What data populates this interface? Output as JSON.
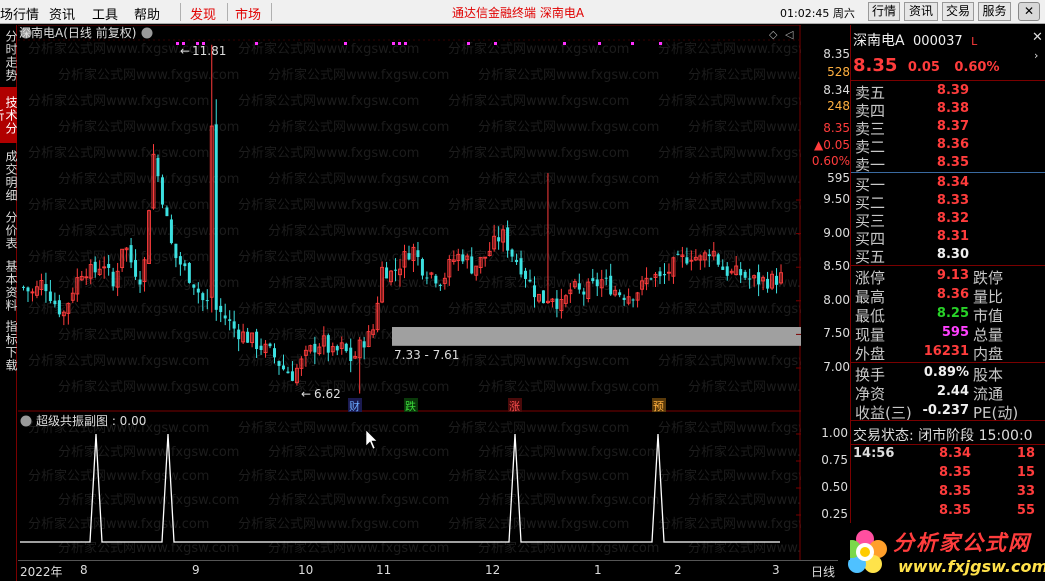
{
  "menu": {
    "items": [
      "场行情",
      "资讯",
      "工具",
      "帮助"
    ],
    "tabs_red": [
      "发现",
      "市场"
    ],
    "center_title": "通达信金融终端   深南电A",
    "clock": "01:02:45 周六",
    "right_buttons": [
      "行情",
      "资讯",
      "交易",
      "服务"
    ]
  },
  "left_tabs": [
    "分时走势",
    "技术分析",
    "成交明细",
    "分价表",
    "基本资料",
    "指标下载"
  ],
  "chart": {
    "title": "深南电A(日线 前复权)",
    "right_labels": {
      "price_hi": "8.35",
      "vol_hi": "528",
      "price_2": "8.34",
      "vol_2": "248",
      "price_3": "8.35",
      "change": "▲0.05",
      "pct": "0.60%",
      "vol_3": "595"
    },
    "annotation_high": "11.81",
    "annotation_low": "6.62",
    "annotation_range": "7.33 - 7.61",
    "event_marks": [
      "财",
      "跌",
      "涨",
      "预"
    ],
    "sub_title": "超级共振副图 : 0.00",
    "watermark": "分析家公式网www.fxgsw.com",
    "x_labels": [
      "2022年",
      "8",
      "9",
      "10",
      "11",
      "12",
      "1",
      "2",
      "3"
    ],
    "day_format": "日线"
  },
  "chart_data": [
    {
      "type": "candlestick",
      "title": "深南电A(日线 前复权)",
      "ylim": [
        6.6,
        11.9
      ],
      "y_ticks": [
        7.0,
        7.5,
        8.0,
        8.5,
        9.0,
        9.5
      ],
      "x_labels": [
        "8",
        "9",
        "10",
        "11",
        "12",
        "1",
        "2",
        "3"
      ],
      "high": 11.81,
      "low": 6.62,
      "gray_band": [
        7.33,
        7.61
      ],
      "close_path": [
        8.2,
        8.1,
        8.3,
        8.0,
        7.8,
        8.2,
        8.5,
        8.4,
        8.6,
        8.2,
        8.9,
        8.5,
        8.3,
        10.2,
        9.5,
        8.7,
        8.5,
        8.3,
        8.0,
        7.9,
        7.8,
        7.6,
        7.5,
        7.4,
        7.3,
        7.2,
        7.0,
        6.9,
        7.1,
        7.3,
        7.4,
        7.2,
        7.3,
        7.1,
        7.4,
        7.5,
        8.5,
        8.4,
        8.6,
        8.8,
        8.5,
        8.4,
        8.3,
        8.6,
        8.7,
        8.5,
        8.6,
        8.8,
        9.0,
        8.7,
        8.5,
        8.2,
        8.0,
        8.1,
        7.9,
        8.2,
        8.1,
        8.2,
        8.3,
        8.2,
        8.1,
        8.1,
        8.2,
        8.4,
        8.3,
        8.5,
        8.6,
        8.7,
        8.6,
        8.8,
        8.5,
        8.4,
        8.4,
        8.3,
        8.3,
        8.3,
        8.35
      ]
    },
    {
      "type": "line",
      "title": "超级共振副图",
      "ylim": [
        0,
        1.0
      ],
      "y_ticks": [
        0.25,
        0.5,
        0.75,
        1.0
      ],
      "spikes_at_x": [
        "8",
        "9",
        "12",
        "2"
      ],
      "spike_value": 1.0
    }
  ],
  "quote": {
    "name": "深南电A",
    "code": "000037",
    "price": "8.35",
    "change": "0.05",
    "pct": "0.60%",
    "asks": [
      {
        "label": "卖五",
        "price": "8.39"
      },
      {
        "label": "卖四",
        "price": "8.38"
      },
      {
        "label": "卖三",
        "price": "8.37"
      },
      {
        "label": "卖二",
        "price": "8.36"
      },
      {
        "label": "卖一",
        "price": "8.35"
      }
    ],
    "bids": [
      {
        "label": "买一",
        "price": "8.34"
      },
      {
        "label": "买二",
        "price": "8.33"
      },
      {
        "label": "买三",
        "price": "8.32"
      },
      {
        "label": "买四",
        "price": "8.31"
      },
      {
        "label": "买五",
        "price": "8.30"
      }
    ],
    "stats": [
      {
        "l": "涨停",
        "v": "9.13",
        "r": "跌停",
        "c": "up"
      },
      {
        "l": "最高",
        "v": "8.36",
        "r": "量比",
        "c": "up"
      },
      {
        "l": "最低",
        "v": "8.25",
        "r": "市值",
        "c": "dn"
      },
      {
        "l": "现量",
        "v": "595",
        "r": "总量",
        "c": "mg"
      },
      {
        "l": "外盘",
        "v": "16231",
        "r": "内盘",
        "c": "up"
      }
    ],
    "fin": [
      {
        "l": "换手",
        "v": "0.89%",
        "r": "股本"
      },
      {
        "l": "净资",
        "v": "2.44",
        "r": "流通"
      },
      {
        "l": "收益(三)",
        "v": "-0.237",
        "r": "PE(动)"
      }
    ],
    "status": "交易状态: 闭市阶段 15:00:0",
    "ticks": [
      {
        "t": "14:56",
        "p": "8.34",
        "q": "18"
      },
      {
        "t": "",
        "p": "8.35",
        "q": "15"
      },
      {
        "t": "",
        "p": "8.35",
        "q": "33"
      },
      {
        "t": "",
        "p": "8.35",
        "q": "55"
      },
      {
        "t": "",
        "p": "8.34",
        "q": "37"
      }
    ]
  },
  "logo": {
    "cn": "分析家公式网",
    "url": "www.fxjgsw.com"
  }
}
